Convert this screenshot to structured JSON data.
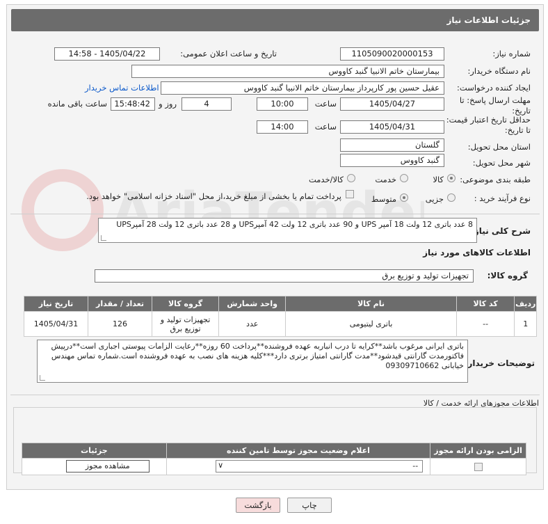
{
  "panel": {
    "title": "جزئیات اطلاعات نیاز"
  },
  "form": {
    "need_number_label": "شماره نیاز:",
    "need_number": "1105090020000153",
    "announce_label": "تاریخ و ساعت اعلان عمومی:",
    "announce_value": "1405/04/22 - 14:58",
    "buyer_org_label": "نام دستگاه خریدار:",
    "buyer_org": "بیمارستان خاتم الانبیا گنبد کاووس",
    "creator_label": "ایجاد کننده درخواست:",
    "creator": "عقیل حسین پور کارپرداز بیمارستان خاتم الانبیا گنبد کاووس",
    "contact_link": "اطلاعات تماس خریدار",
    "send_deadline_label_1": "مهلت ارسال پاسخ: تا",
    "send_deadline_label_2": "تاریخ:",
    "send_date": "1405/04/27",
    "time_label": "ساعت",
    "send_time": "10:00",
    "days_value": "4",
    "days_label": "روز و",
    "remaining_time": "15:48:42",
    "remaining_label": "ساعت باقی مانده",
    "validity_label_1": "حداقل تاریخ اعتبار قیمت:",
    "validity_label_2": "تا تاریخ:",
    "validity_date": "1405/04/31",
    "validity_time": "14:00",
    "province_label": "استان محل تحویل:",
    "province": "گلستان",
    "city_label": "شهر محل تحویل:",
    "city": "گنبد کاووس",
    "category_label": "طبقه بندی موضوعی:",
    "category_options": [
      "کالا",
      "خدمت",
      "کالا/خدمت"
    ],
    "category_selected": "کالا",
    "process_label": "نوع فرآیند خرید :",
    "process_options": [
      "جزیی",
      "متوسط"
    ],
    "process_selected": "متوسط",
    "payment_note": "پرداخت تمام یا بخشی از مبلغ خرید،از محل \"اسناد خزانه اسلامی\" خواهد بود."
  },
  "description": {
    "label": "شرح کلی نیاز:",
    "text": "8 عدد باتری 12 ولت 18 آمپر UPS  و 90 عدد باتری 12 ولت 42 آمپرUPS و  28 عدد باتری 12 ولت 28 آمپرUPS"
  },
  "goods": {
    "section_title": "اطلاعات کالاهای مورد نیاز",
    "group_label": "گروه کالا:",
    "group_value": "تجهیزات تولید و توزیع برق",
    "table": {
      "headers": [
        "ردیف",
        "کد کالا",
        "نام کالا",
        "واحد شمارش",
        "گروه کالا",
        "تعداد / مقدار",
        "تاریخ نیاز"
      ],
      "rows": [
        [
          "1",
          "--",
          "باتری لیتیومی",
          "عدد",
          "تجهیزات تولید و توزیع برق",
          "126",
          "1405/04/31"
        ]
      ]
    }
  },
  "buyer_notes": {
    "label": "توضیحات خریدار:",
    "text": "باتری ایرانی مرغوب باشد**کرایه تا درب انباربه عهده فروشنده**پرداخت  60 روزه**رعایت الزامات پیوستی اجباری است**درپیش فاکتورمدت گارانتی قیدشود**مدت گارانتی امتیاز برتری دارد***کلیه هزینه های نصب به عهده فروشنده است.شماره تماس مهندس خیابانی 09309710662"
  },
  "licenses": {
    "section_title": "اطلاعات مجوزهای ارائه خدمت / کالا",
    "headers": [
      "الزامی بودن ارائه مجوز",
      "اعلام وضعیت مجوز توسط تامین کننده",
      "جزئیات"
    ],
    "select_value": "--",
    "view_button": "مشاهده مجوز"
  },
  "buttons": {
    "print": "چاپ",
    "back": "بازگشت"
  },
  "colors": {
    "header_bg": "#6c6c6c",
    "link": "#0a58ca",
    "back_btn": "#f7dcdc"
  },
  "watermark_text": "AriaTender.neT"
}
